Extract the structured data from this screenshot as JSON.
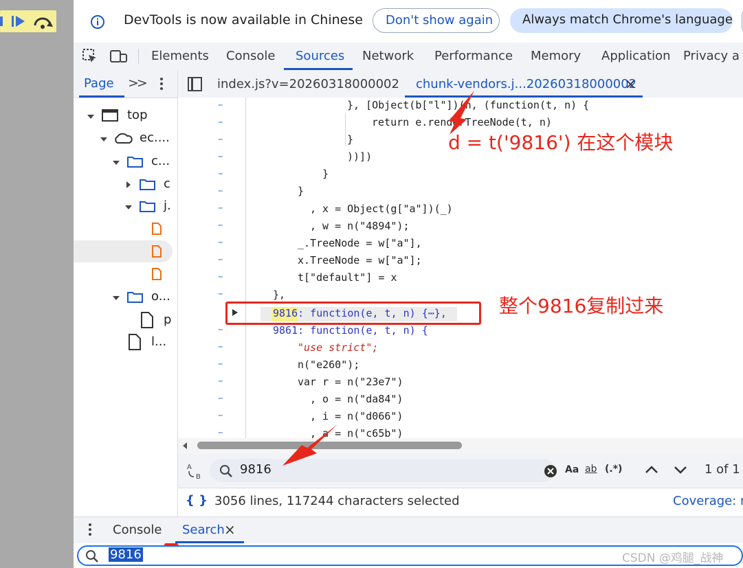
{
  "infobar": {
    "message": "DevTools is now available in Chinese",
    "dont_show": "Don't show again",
    "always_match": "Always match Chrome's language"
  },
  "main_tabs": [
    "Elements",
    "Console",
    "Sources",
    "Network",
    "Performance",
    "Memory",
    "Application",
    "Privacy a"
  ],
  "active_main_tab": "Sources",
  "page_pane": {
    "tab": "Page",
    "more": ">>",
    "tree": [
      "top",
      "ec....",
      "c...",
      "c",
      "j.",
      "o...",
      "p",
      "l..."
    ]
  },
  "file_tabs": {
    "tab1": "index.js?v=20260318000002",
    "tab2": "chunk-vendors.j...20260318000002",
    "close": "×"
  },
  "code_lines": [
    {
      "c": "}, [Object(b[\"l\"])(n, (function(t, n) {"
    },
    {
      "c": "return e.renderTreeNode(t, n)"
    },
    {
      "c": "}"
    },
    {
      "c": "))])"
    },
    {
      "c": "}"
    },
    {
      "c": "}"
    },
    {
      "c": ", x = Object(g[\"a\"])(_)"
    },
    {
      "c": ", w = n(\"4894\");"
    },
    {
      "c": "_.TreeNode = w[\"a\"],"
    },
    {
      "c": "x.TreeNode = w[\"a\"];"
    },
    {
      "c": "t[\"default\"] = x"
    },
    {
      "c": "},"
    },
    {
      "c": "9816: function(e, t, n) {⋯},"
    },
    {
      "c": "9861: function(e, t, n) {"
    },
    {
      "c": "\"use strict\";"
    },
    {
      "c": "n(\"e260\");"
    },
    {
      "c": "var r = n(\"23e7\")"
    },
    {
      "c": ", o = n(\"da84\")"
    },
    {
      "c": ", i = n(\"d066\")"
    },
    {
      "c": ", a = n(\"c65b\")"
    }
  ],
  "annotations": {
    "module_note": "d = t('9816') 在这个模块",
    "copy_note": "整个9816复制过来"
  },
  "search": {
    "query": "9816",
    "match_case": "Aa",
    "whole_word": "ab",
    "regex": "(.*)",
    "count": "1 of 1"
  },
  "status": {
    "braces": "{ }",
    "selection": "3056 lines, 117244 characters selected",
    "coverage": "Coverage: n"
  },
  "drawer": {
    "console_tab": "Console",
    "search_tab": "Search",
    "close": "×",
    "query": "9816"
  },
  "watermark": "CSDN @鸡腿_战神"
}
